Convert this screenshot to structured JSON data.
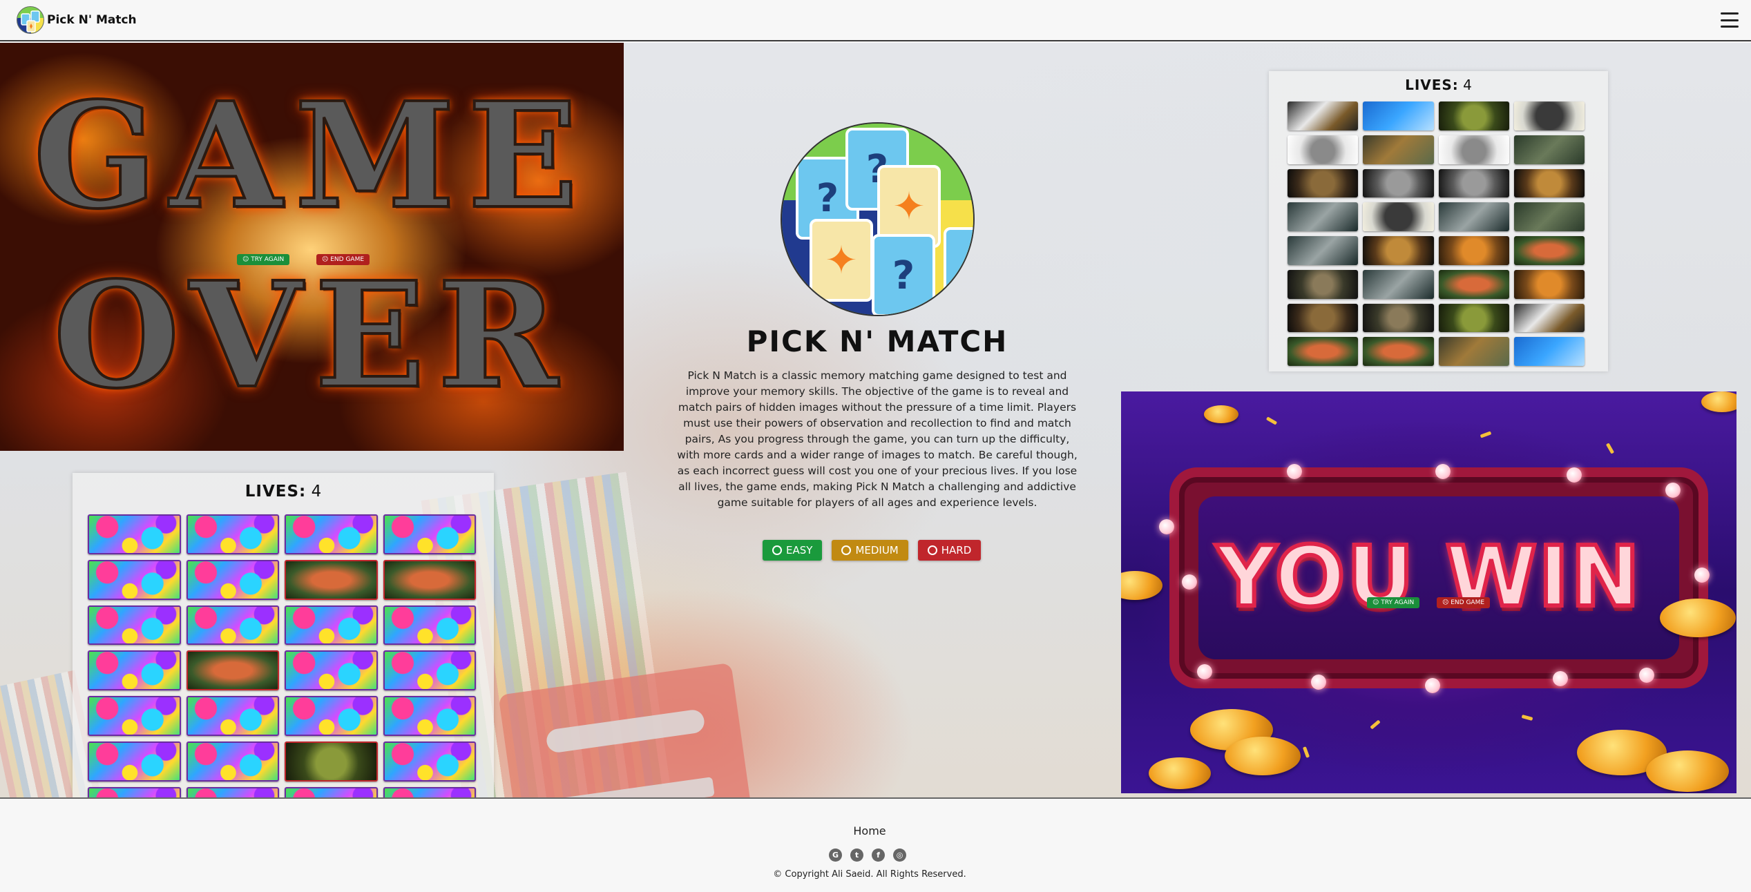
{
  "nav": {
    "brand": "Pick N' Match",
    "menu_icon": "hamburger-menu-icon"
  },
  "game_over": {
    "line1": "GAME",
    "line2": "OVER",
    "try_again": "☺ TRY AGAIN",
    "end_game": "☹ END GAME"
  },
  "intro": {
    "title": "PICK N' MATCH",
    "description": "Pick N Match is a classic memory matching game designed to test and improve your memory skills. The objective of the game is to reveal and match pairs of hidden images without the pressure of a time limit. Players must use their powers of observation and recollection to find and match pairs, As you progress through the game, you can turn up the difficulty, with more cards and a wider range of images to match. Be careful though, as each incorrect guess will cost you one of your precious lives. If you lose all lives, the game ends, making Pick N Match a challenging and addictive game suitable for players of all ages and experience levels.",
    "difficulty": {
      "easy": "EASY",
      "medium": "MEDIUM",
      "hard": "HARD"
    }
  },
  "board_preview": {
    "lives_label": "LIVES:",
    "lives_value": "4",
    "tiles": [
      "eagle",
      "bird",
      "frog",
      "gorilla",
      "cat",
      "tiger",
      "cat",
      "deer",
      "owl",
      "dog",
      "dog",
      "lion",
      "wolf",
      "gorilla",
      "wolf",
      "deer",
      "wolf",
      "lion",
      "fox",
      "fish",
      "snake",
      "wolf",
      "fish",
      "fox",
      "owl",
      "snake",
      "frog",
      "eagle",
      "fish",
      "fish",
      "tiger",
      "bird"
    ]
  },
  "board_play": {
    "lives_label": "LIVES:",
    "lives_value": "4",
    "tiles": [
      "hidden",
      "hidden",
      "hidden",
      "hidden",
      "hidden",
      "hidden",
      "fish",
      "fish",
      "hidden",
      "hidden",
      "hidden",
      "hidden",
      "hidden",
      "fish",
      "hidden",
      "hidden",
      "hidden",
      "hidden",
      "hidden",
      "hidden",
      "hidden",
      "hidden",
      "frog",
      "hidden",
      "hidden",
      "hidden",
      "hidden",
      "hidden",
      "hidden",
      "hidden",
      "hidden",
      "hidden"
    ]
  },
  "you_win": {
    "word": "YOU WIN",
    "try_again": "☺ TRY AGAIN",
    "end_game": "☹ END GAME"
  },
  "footer": {
    "home": "Home",
    "socials": [
      "github-icon",
      "twitter-icon",
      "facebook-icon",
      "instagram-icon"
    ],
    "copyright": "© Copyright Ali Saeid. All Rights Reserved."
  },
  "colors": {
    "easy": "#1a9a3c",
    "medium": "#c18a12",
    "hard": "#c0262c"
  }
}
